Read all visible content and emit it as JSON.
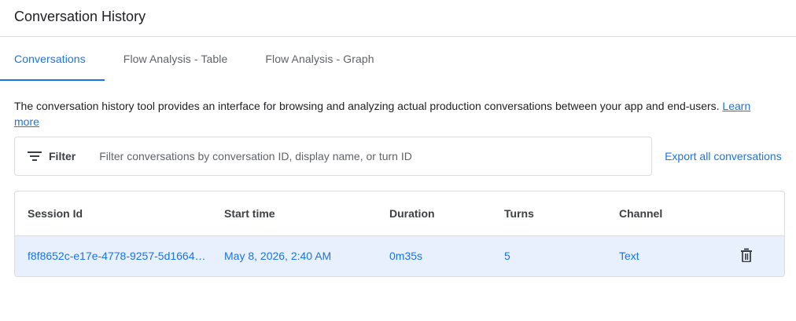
{
  "header": {
    "title": "Conversation History"
  },
  "tabs": [
    {
      "label": "Conversations",
      "active": true
    },
    {
      "label": "Flow Analysis - Table",
      "active": false
    },
    {
      "label": "Flow Analysis - Graph",
      "active": false
    }
  ],
  "description": {
    "text": "The conversation history tool provides an interface for browsing and analyzing actual production conversations between your app and end-users.",
    "link_label": "Learn more"
  },
  "filter": {
    "icon": "filter-list-icon",
    "label": "Filter",
    "placeholder": "Filter conversations by conversation ID, display name, or turn ID",
    "value": ""
  },
  "export": {
    "label": "Export all conversations"
  },
  "table": {
    "columns": [
      "Session Id",
      "Start time",
      "Duration",
      "Turns",
      "Channel"
    ],
    "rows": [
      {
        "session_id": "f8f8652c-e17e-4778-9257-5d1664…",
        "start_time": "May 8, 2026, 2:40 AM",
        "duration": "0m35s",
        "turns": "5",
        "channel": "Text",
        "action_icon": "delete-icon"
      }
    ]
  },
  "colors": {
    "accent": "#1a73e8",
    "selected_row": "#e8f0fe",
    "border": "#dadce0"
  }
}
